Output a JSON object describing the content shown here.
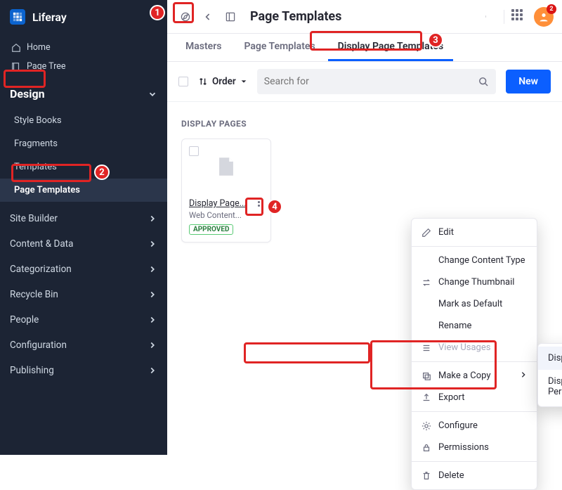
{
  "brand": {
    "name": "Liferay"
  },
  "nav": {
    "home": "Home",
    "page_tree": "Page Tree",
    "design_label": "Design",
    "design_children": {
      "style_books": "Style Books",
      "fragments": "Fragments",
      "templates": "Templates",
      "page_templates": "Page Templates"
    },
    "site_builder": "Site Builder",
    "content_data": "Content & Data",
    "categorization": "Categorization",
    "recycle_bin": "Recycle Bin",
    "people": "People",
    "configuration": "Configuration",
    "publishing": "Publishing"
  },
  "header": {
    "title": "Page Templates",
    "notif_count": "2"
  },
  "tabs": {
    "masters": "Masters",
    "page_templates": "Page Templates",
    "display_page_templates": "Display Page Templates"
  },
  "toolbar": {
    "order": "Order",
    "search_placeholder": "Search for",
    "new": "New"
  },
  "section": {
    "display_pages_label": "DISPLAY PAGES"
  },
  "card": {
    "title": "Display Page...",
    "subtitle": "Web Content...",
    "badge": "APPROVED"
  },
  "menu": {
    "edit": "Edit",
    "change_content_type": "Change Content Type",
    "change_thumbnail": "Change Thumbnail",
    "mark_default": "Mark as Default",
    "rename": "Rename",
    "view_usages": "View Usages",
    "make_copy": "Make a Copy",
    "export": "Export",
    "configure": "Configure",
    "permissions": "Permissions",
    "delete": "Delete"
  },
  "submenu": {
    "display_page": "Display Page",
    "display_page_perm": "Display Page With Permissions"
  },
  "callouts": {
    "c1": "1",
    "c2": "2",
    "c3": "3",
    "c4": "4"
  }
}
